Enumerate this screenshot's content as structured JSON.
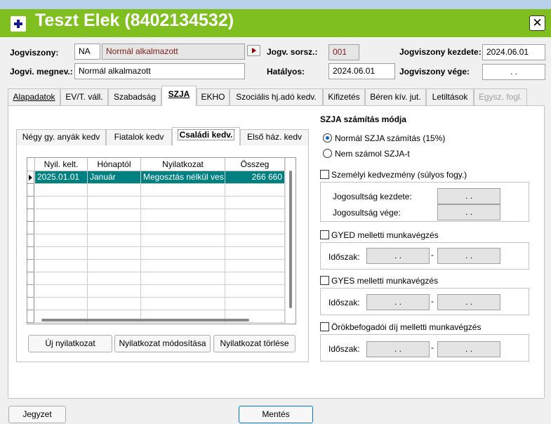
{
  "window": {
    "title": "Teszt Elek (8402134532)",
    "close_symbol": "✕"
  },
  "header": {
    "jogviszony_label": "Jogviszony:",
    "jogviszony_code": "NA",
    "jogviszony_name": "Normál alkalmazott",
    "sorsz_label": "Jogv. sorsz.:",
    "sorsz_value": "001",
    "kezdete_label": "Jogviszony kezdete:",
    "kezdete_value": "2024.06.01",
    "megnev_label": "Jogvi. megnev.:",
    "megnev_value": "Normál alkalmazott",
    "hatalyos_label": "Hatályos:",
    "hatalyos_value": "2024.06.01",
    "vege_label": "Jogviszony vége:",
    "vege_value": ". ."
  },
  "tabs": [
    "Alapadatok",
    "EV/T. váll.",
    "Szabadság",
    "SZJA",
    "EKHO",
    "Szociális hj.adó kedv.",
    "Kifizetés",
    "Béren kív. jut.",
    "Letiltások",
    "Egysz. fogl."
  ],
  "subtabs": [
    "Négy gy. anyák kedv",
    "Fiatalok kedv",
    "Családi kedv.",
    "Első ház. kedv"
  ],
  "grid": {
    "columns": [
      "Nyil. kelt.",
      "Hónaptól",
      "Nyilatkozat",
      "Összeg"
    ],
    "rows": [
      {
        "kelt": "2025.01.01",
        "honap": "Január",
        "nyilatkozat": "Megosztás nélkül ves",
        "osszeg": "266 660"
      }
    ]
  },
  "buttons": {
    "uj": "Új nyilatkozat",
    "modositas": "Nyilatkozat módosítása",
    "torles": "Nyilatkozat törlése",
    "jegyzet": "Jegyzet",
    "mentes": "Mentés"
  },
  "szja": {
    "title": "SZJA számítás módja",
    "option_normal": "Normál SZJA számítás (15%)",
    "option_none": "Nem számol SZJA-t",
    "selected": "option_normal"
  },
  "szemelyi": {
    "label": "Személyi kedvezmény (súlyos fogy.)",
    "checked": false,
    "kezdete_label": "Jogosultság kezdete:",
    "kezdete_value": ". .",
    "vege_label": "Jogosultság vége:",
    "vege_value": ". ."
  },
  "gyed": {
    "label": "GYED melletti munkavégzés",
    "checked": false,
    "idoszak_label": "Időszak:",
    "from": ". .",
    "sep": "-",
    "to": ". ."
  },
  "gyes": {
    "label": "GYES melletti munkavégzés",
    "checked": false,
    "idoszak_label": "Időszak:",
    "from": ". .",
    "sep": "-",
    "to": ". ."
  },
  "orokbe": {
    "label": "Örökbefogadói díj melletti munkavégzés",
    "checked": false,
    "idoszak_label": "Időszak:",
    "from": ". .",
    "sep": "-",
    "to": ". ."
  },
  "colors": {
    "titlebar": "#7fbf1f",
    "selected_row": "#008080",
    "primary_border": "#0078d7"
  }
}
